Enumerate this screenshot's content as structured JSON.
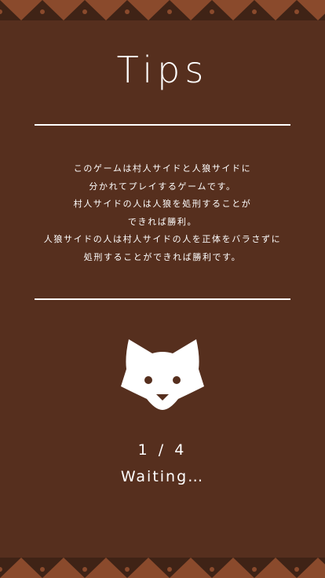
{
  "screen": {
    "title": "Tips",
    "tip_lines": [
      "このゲームは村人サイドと人狼サイドに",
      "分かれてプレイするゲームです。",
      "村人サイドの人は人狼を処刑することが",
      "できれば勝利。",
      "人狼サイドの人は村人サイドの人を正体をバラさずに",
      "処刑することができれば勝利です。"
    ],
    "progress": "1 / 4",
    "status": "Waiting…"
  },
  "colors": {
    "background": "#562f1e",
    "border_dark": "#3f2316",
    "border_light": "#8a4a2c",
    "text": "#ffffff"
  },
  "icons": {
    "mascot": "wolf-face-icon",
    "border_pattern": "zigzag-border"
  }
}
